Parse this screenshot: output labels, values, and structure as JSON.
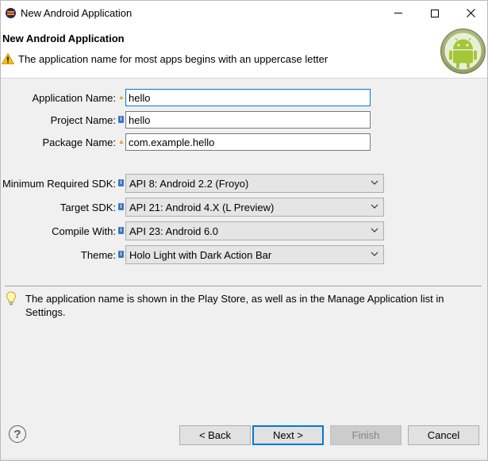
{
  "window": {
    "title": "New Android Application"
  },
  "banner": {
    "title": "New Android Application",
    "message": "The application name for most apps begins with an uppercase letter"
  },
  "form": {
    "app_name": {
      "label": "Application Name:",
      "value": "hello"
    },
    "project_name": {
      "label": "Project Name:",
      "value": "hello"
    },
    "package_name": {
      "label": "Package Name:",
      "value": "com.example.hello"
    },
    "min_sdk": {
      "label": "Minimum Required SDK:",
      "value": "API 8: Android 2.2 (Froyo)"
    },
    "target_sdk": {
      "label": "Target SDK:",
      "value": "API 21: Android 4.X (L Preview)"
    },
    "compile_with": {
      "label": "Compile With:",
      "value": "API 23: Android 6.0"
    },
    "theme": {
      "label": "Theme:",
      "value": "Holo Light with Dark Action Bar"
    }
  },
  "description": "The application name is shown in the Play Store, as well as in the Manage Application list in Settings.",
  "buttons": {
    "back": "< Back",
    "next": "Next >",
    "finish": "Finish",
    "cancel": "Cancel"
  },
  "icons": {
    "help": "?",
    "warning": "warning-icon",
    "bulb": "lightbulb-icon"
  },
  "colors": {
    "accent": "#0078d7",
    "android_green": "#a4c639",
    "warning": "#e0a000",
    "info": "#3b77c2"
  }
}
